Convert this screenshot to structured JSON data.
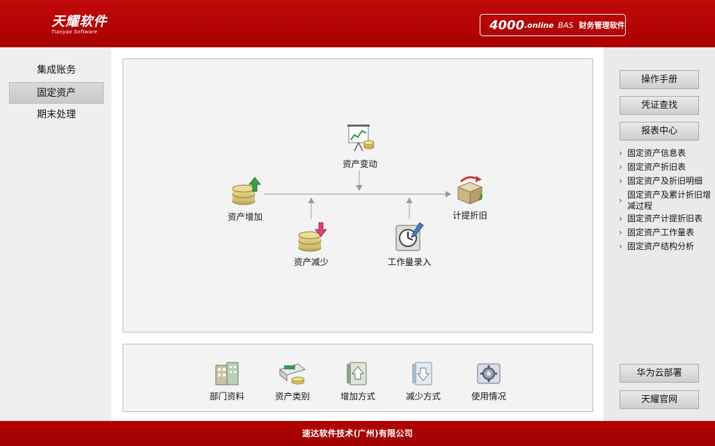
{
  "header": {
    "logo_cn": "天耀软件",
    "logo_en": "Tianyao Software",
    "product_num": "4000",
    "product_online": ".online",
    "product_bas": "BAS",
    "product_text": "财务管理软件"
  },
  "leftnav": {
    "items": [
      {
        "label": "集成账务"
      },
      {
        "label": "固定资产",
        "active": true
      },
      {
        "label": "期末处理"
      }
    ]
  },
  "flow": {
    "nodes": {
      "change": {
        "label": "资产变动",
        "icon": "presentation-chart-icon"
      },
      "increase": {
        "label": "资产增加",
        "icon": "coins-up-icon"
      },
      "decrease": {
        "label": "资产减少",
        "icon": "coins-down-icon"
      },
      "workload": {
        "label": "工作量录入",
        "icon": "clock-pen-icon"
      },
      "depreciation": {
        "label": "计提折旧",
        "icon": "box-cycle-icon"
      }
    }
  },
  "setup": {
    "tools": [
      {
        "label": "部门资料",
        "icon": "building-icon"
      },
      {
        "label": "资产类别",
        "icon": "asset-category-icon"
      },
      {
        "label": "增加方式",
        "icon": "add-mode-icon"
      },
      {
        "label": "减少方式",
        "icon": "reduce-mode-icon"
      },
      {
        "label": "使用情况",
        "icon": "usage-gear-icon"
      }
    ]
  },
  "right": {
    "manual": "操作手册",
    "voucher_search": "凭证查找",
    "report_center": "报表中心",
    "reports": [
      "固定资产信息表",
      "固定资产折旧表",
      "固定资产及折旧明细",
      "固定资产及累计折旧增减过程",
      "固定资产计提折旧表",
      "固定资产工作量表",
      "固定资产结构分析"
    ],
    "huawei_cloud": "华为云部署",
    "official_site": "天耀官网"
  },
  "footer": {
    "company": "速达软件技术(广州)有限公司"
  },
  "colors": {
    "brand_red": "#b00000",
    "panel_bg": "#f3f3f3"
  }
}
